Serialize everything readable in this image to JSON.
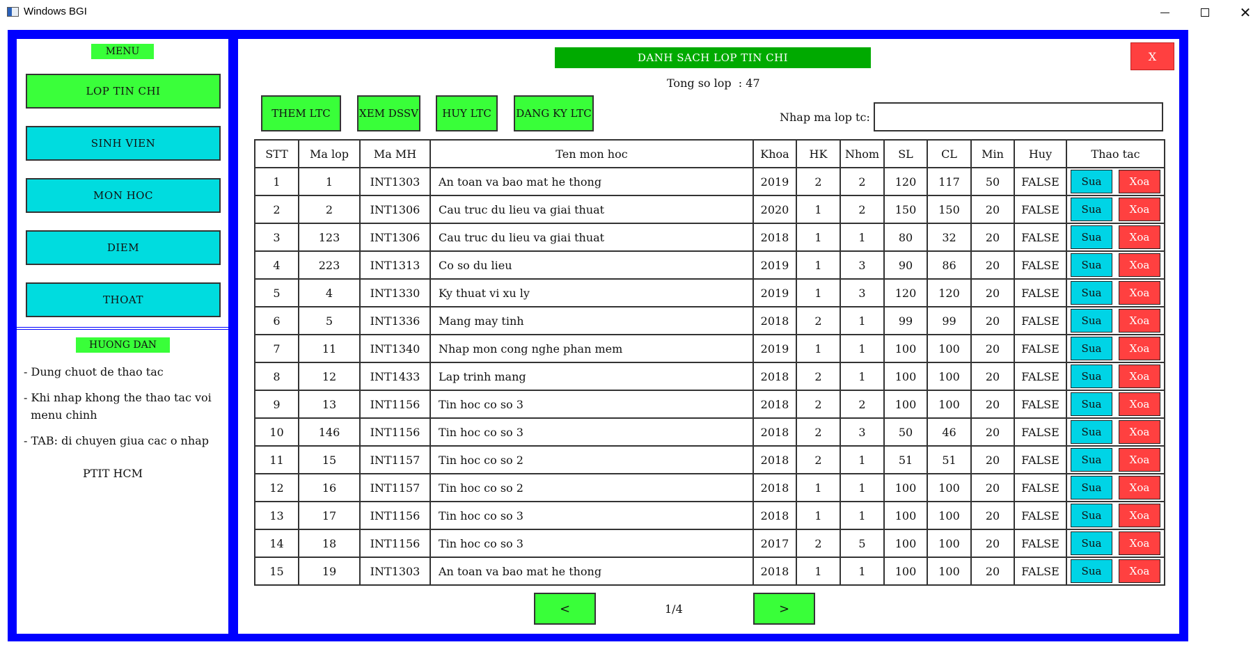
{
  "window": {
    "title": "Windows BGI",
    "controls": [
      "minimize-icon",
      "maximize-icon",
      "close-icon"
    ]
  },
  "sidebar": {
    "menu_label": "MENU",
    "items": [
      {
        "label": "LOP TIN CHI",
        "active": true
      },
      {
        "label": "SINH VIEN",
        "active": false
      },
      {
        "label": "MON HOC",
        "active": false
      },
      {
        "label": "DIEM",
        "active": false
      },
      {
        "label": "THOAT",
        "active": false
      }
    ],
    "guide_label": "HUONG DAN",
    "guide_items": [
      "- Dung chuot de thao tac",
      "- Khi nhap khong the thao tac voi\n  menu chinh",
      "- TAB: di chuyen giua cac o nhap"
    ],
    "school": "PTIT HCM"
  },
  "main": {
    "title": "DANH SACH LOP TIN CHI",
    "close_label": "X",
    "total_text": "Tong so lop  : 47",
    "actions": [
      "THEM LTC",
      "XEM DSSV",
      "HUY LTC",
      "DANG KY LTC"
    ],
    "search_label": "Nhap ma lop tc:",
    "search_value": "",
    "table": {
      "headers": [
        "STT",
        "Ma lop",
        "Ma MH",
        "Ten mon hoc",
        "Khoa",
        "HK",
        "Nhom",
        "SL",
        "CL",
        "Min",
        "Huy",
        "Thao tac"
      ],
      "edit_label": "Sua",
      "delete_label": "Xoa",
      "rows": [
        [
          "1",
          "1",
          "INT1303",
          "An toan va bao mat he thong",
          "2019",
          "2",
          "2",
          "120",
          "117",
          "50",
          "FALSE"
        ],
        [
          "2",
          "2",
          "INT1306",
          "Cau truc du lieu va giai thuat",
          "2020",
          "1",
          "2",
          "150",
          "150",
          "20",
          "FALSE"
        ],
        [
          "3",
          "123",
          "INT1306",
          "Cau truc du lieu va giai thuat",
          "2018",
          "1",
          "1",
          "80",
          "32",
          "20",
          "FALSE"
        ],
        [
          "4",
          "223",
          "INT1313",
          "Co so du lieu",
          "2019",
          "1",
          "3",
          "90",
          "86",
          "20",
          "FALSE"
        ],
        [
          "5",
          "4",
          "INT1330",
          "Ky thuat vi xu ly",
          "2019",
          "1",
          "3",
          "120",
          "120",
          "20",
          "FALSE"
        ],
        [
          "6",
          "5",
          "INT1336",
          "Mang may tinh",
          "2018",
          "2",
          "1",
          "99",
          "99",
          "20",
          "FALSE"
        ],
        [
          "7",
          "11",
          "INT1340",
          "Nhap mon cong nghe phan mem",
          "2019",
          "1",
          "1",
          "100",
          "100",
          "20",
          "FALSE"
        ],
        [
          "8",
          "12",
          "INT1433",
          "Lap trinh mang",
          "2018",
          "2",
          "1",
          "100",
          "100",
          "20",
          "FALSE"
        ],
        [
          "9",
          "13",
          "INT1156",
          "Tin hoc co so 3",
          "2018",
          "2",
          "2",
          "100",
          "100",
          "20",
          "FALSE"
        ],
        [
          "10",
          "146",
          "INT1156",
          "Tin hoc co so 3",
          "2018",
          "2",
          "3",
          "50",
          "46",
          "20",
          "FALSE"
        ],
        [
          "11",
          "15",
          "INT1157",
          "Tin hoc co so 2",
          "2018",
          "2",
          "1",
          "51",
          "51",
          "20",
          "FALSE"
        ],
        [
          "12",
          "16",
          "INT1157",
          "Tin hoc co so 2",
          "2018",
          "1",
          "1",
          "100",
          "100",
          "20",
          "FALSE"
        ],
        [
          "13",
          "17",
          "INT1156",
          "Tin hoc co so 3",
          "2018",
          "1",
          "1",
          "100",
          "100",
          "20",
          "FALSE"
        ],
        [
          "14",
          "18",
          "INT1156",
          "Tin hoc co so 3",
          "2017",
          "2",
          "5",
          "100",
          "100",
          "20",
          "FALSE"
        ],
        [
          "15",
          "19",
          "INT1303",
          "An toan va bao mat he thong",
          "2018",
          "1",
          "1",
          "100",
          "100",
          "20",
          "FALSE"
        ]
      ]
    },
    "pagination": {
      "prev_label": "<",
      "next_label": ">",
      "page_text": "1/4"
    }
  },
  "colors": {
    "frame": "#0000ff",
    "green_button": "#39ff39",
    "cyan_button": "#00dcdf",
    "title_bar": "#00aa00",
    "delete_red": "#ff4040"
  }
}
